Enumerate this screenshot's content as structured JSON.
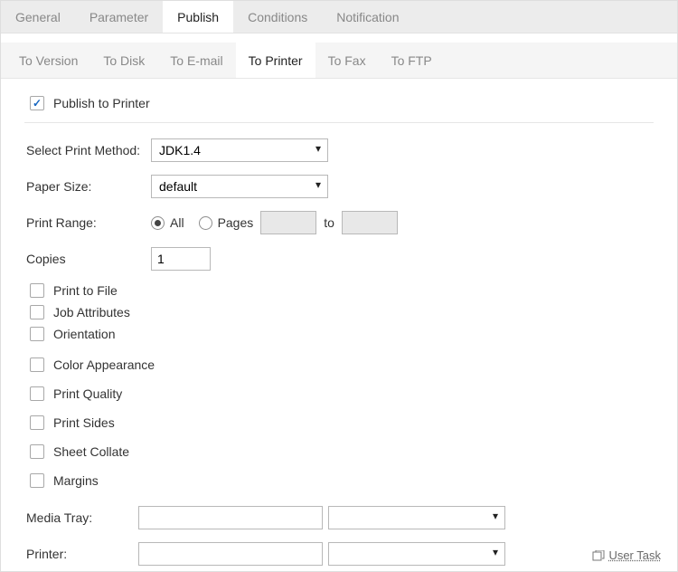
{
  "top_tabs": {
    "general": "General",
    "parameter": "Parameter",
    "publish": "Publish",
    "conditions": "Conditions",
    "notification": "Notification"
  },
  "sub_tabs": {
    "to_version": "To Version",
    "to_disk": "To Disk",
    "to_email": "To E-mail",
    "to_printer": "To Printer",
    "to_fax": "To Fax",
    "to_ftp": "To FTP"
  },
  "publish_to_printer": "Publish to Printer",
  "labels": {
    "select_print_method": "Select Print Method:",
    "paper_size": "Paper Size:",
    "print_range": "Print Range:",
    "all": "All",
    "pages": "Pages",
    "to": "to",
    "copies": "Copies",
    "print_to_file": "Print to File",
    "job_attributes": "Job Attributes",
    "orientation": "Orientation",
    "color_appearance": "Color Appearance",
    "print_quality": "Print Quality",
    "print_sides": "Print Sides",
    "sheet_collate": "Sheet Collate",
    "margins": "Margins",
    "media_tray": "Media Tray:",
    "printer": "Printer:"
  },
  "values": {
    "print_method": "JDK1.4",
    "paper_size": "default",
    "copies": "1",
    "media_tray_text": "",
    "media_tray_select": "",
    "printer_text": "",
    "printer_select": "",
    "range_from": "",
    "range_to": ""
  },
  "footer": {
    "user_task": "User Task"
  }
}
